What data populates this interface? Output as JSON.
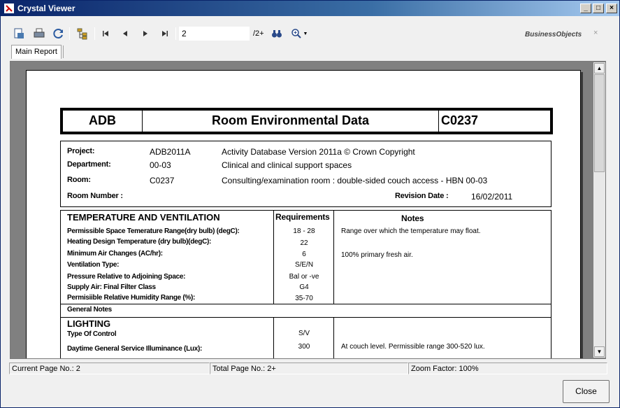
{
  "window": {
    "title": "Crystal Viewer"
  },
  "toolbar": {
    "page_value": "2",
    "page_total": "/2+",
    "brand": "BusinessObjects",
    "brand_close": "×"
  },
  "tabs": [
    {
      "label": "Main Report"
    }
  ],
  "report": {
    "header": {
      "left": "ADB",
      "center": "Room Environmental Data",
      "right": "C0237"
    },
    "project": {
      "project_label": "Project:",
      "project_code": "ADB2011A",
      "project_desc": "Activity Database Version  2011a © Crown Copyright",
      "department_label": "Department:",
      "department_code": "00-03",
      "department_desc": "Clinical and clinical support spaces",
      "room_label": "Room:",
      "room_code": "C0237",
      "room_desc": "Consulting/examination room : double-sided couch access - HBN 00-03",
      "room_number_label": "Room Number :",
      "revision_label": "Revision Date :",
      "revision_date": "16/02/2011"
    },
    "temperature": {
      "title": "TEMPERATURE AND VENTILATION",
      "req_header": "Requirements",
      "notes_header": "Notes",
      "rows": [
        {
          "label": "Permissible Space Temerature Range(dry bulb) (degC):",
          "value": "18 - 28",
          "note": "Range over which the temperature may float."
        },
        {
          "label": "Heating Design Temperature (dry bulb)(degC):",
          "value": "22",
          "note": ""
        },
        {
          "label": "Minimum Air Changes (AC/hr):",
          "value": "6",
          "note": "100% primary fresh air."
        },
        {
          "label": "Ventilation Type:",
          "value": "S/E/N",
          "note": ""
        },
        {
          "label": "Pressure Relative to Adjoining Space:",
          "value": "Bal or -ve",
          "note": ""
        },
        {
          "label": "Supply Air: Final Filter Class",
          "value": "G4",
          "note": ""
        },
        {
          "label": "Permisiible Relative Humidity Range (%):",
          "value": "35-70",
          "note": ""
        }
      ],
      "general_notes": "General Notes"
    },
    "lighting": {
      "title": "LIGHTING",
      "rows": [
        {
          "label": "Type Of Control",
          "value": "S/V",
          "note": ""
        },
        {
          "label": "Daytime General Service Illuminance (Lux):",
          "value": "300",
          "note": "At couch level. Permissible range 300-520 lux."
        }
      ]
    }
  },
  "status": {
    "current_page": "Current Page No.: 2",
    "total_page": "Total Page No.: 2+",
    "zoom": "Zoom Factor: 100%"
  },
  "buttons": {
    "close": "Close"
  }
}
